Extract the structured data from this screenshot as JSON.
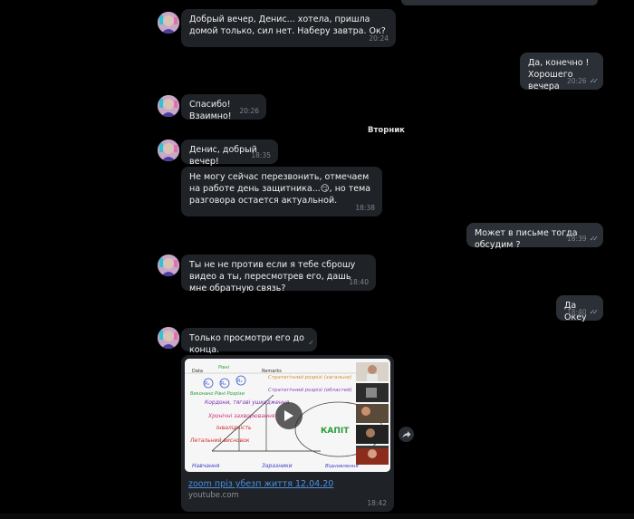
{
  "messages": [
    {
      "text": "Добрый вечер, Денис... хотела, пришла домой только, сил нет. Наберу завтра. Ок?",
      "time": "20:24"
    },
    {
      "text": "Да, конечно !\nХорошего вечера",
      "time": "20:26"
    },
    {
      "text": "Спасибо! Взаимно!",
      "time": "20:26"
    },
    {
      "text": "Денис, добрый вечер!",
      "time": "18:35"
    },
    {
      "text": "Не могу сейчас перезвонить, отмечаем на работе день защитника...😏, но тема разговора остается актуальной.",
      "time": "18:38"
    },
    {
      "text": "Может в письме тогда обсудим ?",
      "time": "18:39"
    },
    {
      "text": "Ты не не против если я тебе сброшу видео а ты, пересмотрев его, дашь мне обратную связь?",
      "time": "18:40"
    },
    {
      "text": "Да Океу",
      "time": "18:40"
    },
    {
      "text": "Только просмотри его до конца.",
      "time": ""
    }
  ],
  "day_separator": "Вторник",
  "video_card": {
    "title": "zoom пріз убезп життя 12.04.20",
    "site": "youtube.com",
    "time": "18:42",
    "thumb_texts": {
      "data": "Data",
      "remarks": "Remarks",
      "level": "Рівні",
      "r1": "R₁",
      "r2": "R₂",
      "r3": "R₃",
      "column_labels": "Виконано  Рівні  Розрізи",
      "l1": "Стратегічний розрізі (загальне)",
      "l2": "Стратегічний розрізі (областей)",
      "l3": "Кордони, тягові ушкодження",
      "l4": "Хронічні захворювання",
      "l5": "Інвалідність",
      "l6": "Летальний висновок",
      "b1": "Навчання",
      "b2": "Заразники",
      "b3": "Відновлення",
      "center": "КАПІТ"
    }
  },
  "colors": {
    "background": "#000000",
    "bubble_in": "#1f2227",
    "bubble_out": "#2b2f36",
    "time": "#7d8590",
    "link": "#4a90e2",
    "read_checks": "#8fa0b5"
  },
  "icons": [
    "avatar",
    "double-check-icon",
    "single-check-icon",
    "share-icon",
    "play-icon"
  ]
}
